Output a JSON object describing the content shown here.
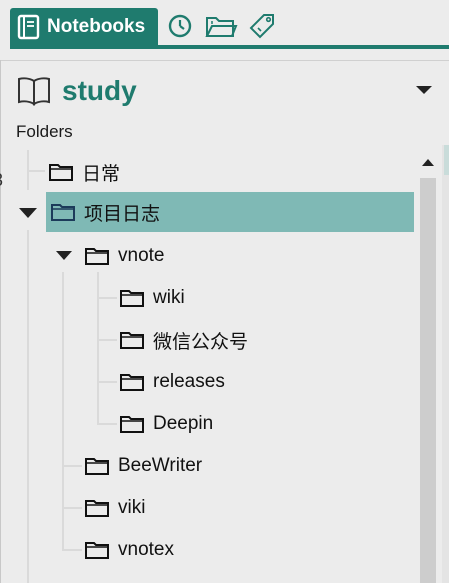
{
  "tabs": {
    "notebooks_label": "Notebooks"
  },
  "notebook": {
    "name": "study"
  },
  "folders_label": "Folders",
  "tree": {
    "daily": "日常",
    "project_log": "项目日志",
    "vnote": "vnote",
    "wiki": "wiki",
    "wechat": "微信公众号",
    "releases": "releases",
    "deepin": "Deepin",
    "beewriter": "BeeWriter",
    "viki": "viki",
    "vnotex": "vnotex"
  },
  "colors": {
    "accent": "#1f7b6e",
    "selection": "#7fb9b5",
    "background": "#ececec"
  }
}
